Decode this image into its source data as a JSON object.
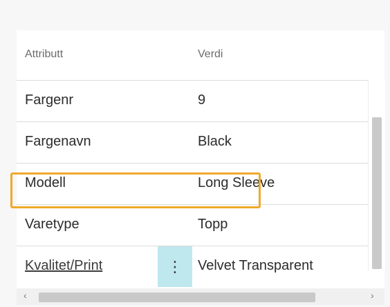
{
  "table": {
    "headers": {
      "attribute": "Attributt",
      "value": "Verdi"
    },
    "rows": [
      {
        "attribute": "Fargenr",
        "value": "9"
      },
      {
        "attribute": "Fargenavn",
        "value": "Black"
      },
      {
        "attribute": "Modell",
        "value": "Long Sleeve"
      },
      {
        "attribute": "Varetype",
        "value": "Topp"
      },
      {
        "attribute": "Kvalitet/Print",
        "value": "Velvet Transparent"
      }
    ],
    "row_menu_icon": "⋮"
  },
  "scroll": {
    "left_arrow": "‹",
    "right_arrow": "›"
  },
  "colors": {
    "highlight": "#f0a92a",
    "row_menu_bg": "#bfe7ee"
  }
}
